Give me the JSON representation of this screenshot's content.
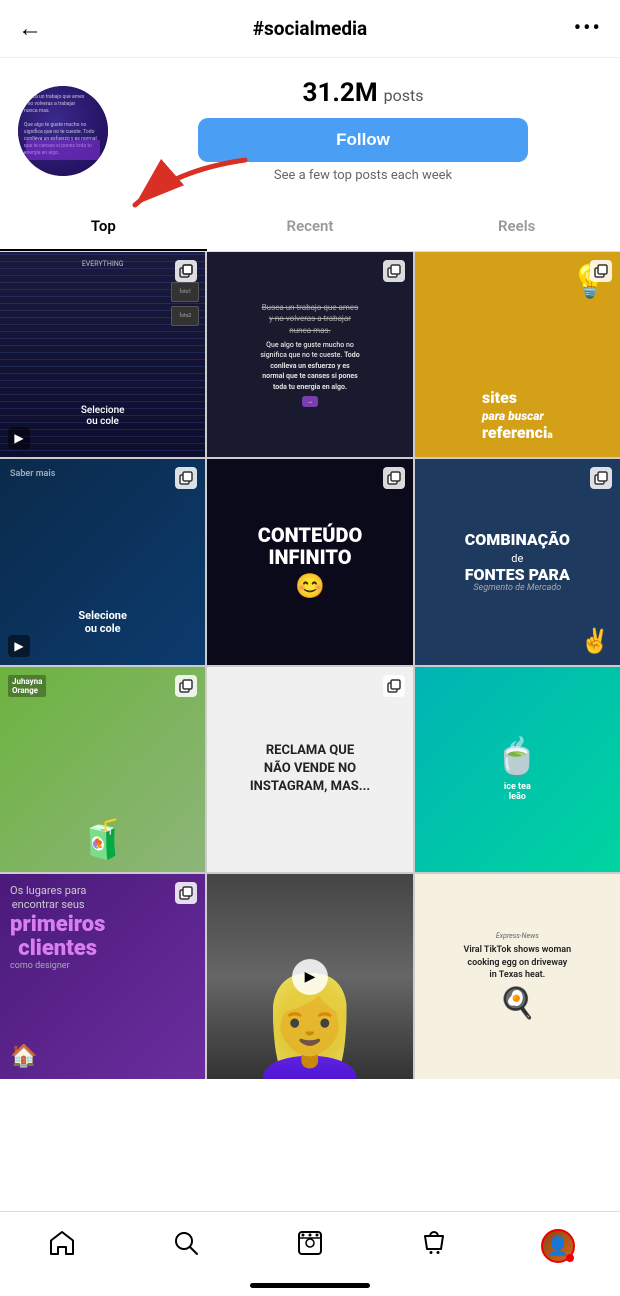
{
  "header": {
    "back_icon": "←",
    "title": "#socialmedia",
    "more_icon": "•••"
  },
  "profile": {
    "posts_count": "31.2M",
    "posts_label": "posts",
    "follow_label": "Follow",
    "subtext": "See a few top posts each week"
  },
  "tabs": [
    {
      "label": "Top",
      "active": true
    },
    {
      "label": "Recent",
      "active": false
    },
    {
      "label": "Reels",
      "active": false
    }
  ],
  "grid": [
    {
      "id": 1,
      "type": "multi",
      "has_reels": true
    },
    {
      "id": 2,
      "type": "multi"
    },
    {
      "id": 3,
      "type": "multi"
    },
    {
      "id": 4,
      "type": "multi",
      "has_reels": true
    },
    {
      "id": 5,
      "type": "multi"
    },
    {
      "id": 6,
      "type": "multi"
    },
    {
      "id": 7,
      "type": "multi"
    },
    {
      "id": 8,
      "type": "multi"
    },
    {
      "id": 9,
      "type": "single"
    },
    {
      "id": 10,
      "type": "multi"
    },
    {
      "id": 11,
      "type": "play"
    },
    {
      "id": 12,
      "type": "single"
    }
  ],
  "nav": {
    "home_label": "home",
    "search_label": "search",
    "reels_label": "reels",
    "shop_label": "shop",
    "profile_label": "profile"
  }
}
